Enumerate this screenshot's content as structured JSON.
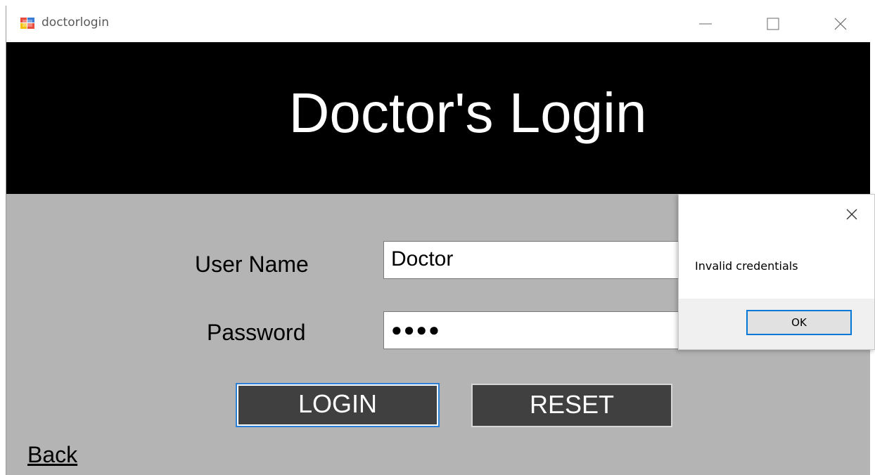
{
  "window": {
    "title": "doctorlogin",
    "controls": {
      "minimize_icon": "minimize-icon",
      "maximize_icon": "maximize-icon",
      "close_icon": "close-icon"
    }
  },
  "banner": {
    "title": "Doctor's Login",
    "background": "#000000",
    "text_color": "#ffffff"
  },
  "form": {
    "username_label": "User Name",
    "username_value": "Doctor",
    "password_label": "Password",
    "password_value": "●●●●",
    "login_label": "LOGIN",
    "reset_label": "RESET",
    "back_label": "Back"
  },
  "message_box": {
    "text": "Invalid credentials",
    "ok_label": "OK",
    "close_icon": "close-icon"
  },
  "colors": {
    "form_background": "#b4b4b4",
    "button_background": "#404040",
    "focus_accent": "#0078d7"
  }
}
